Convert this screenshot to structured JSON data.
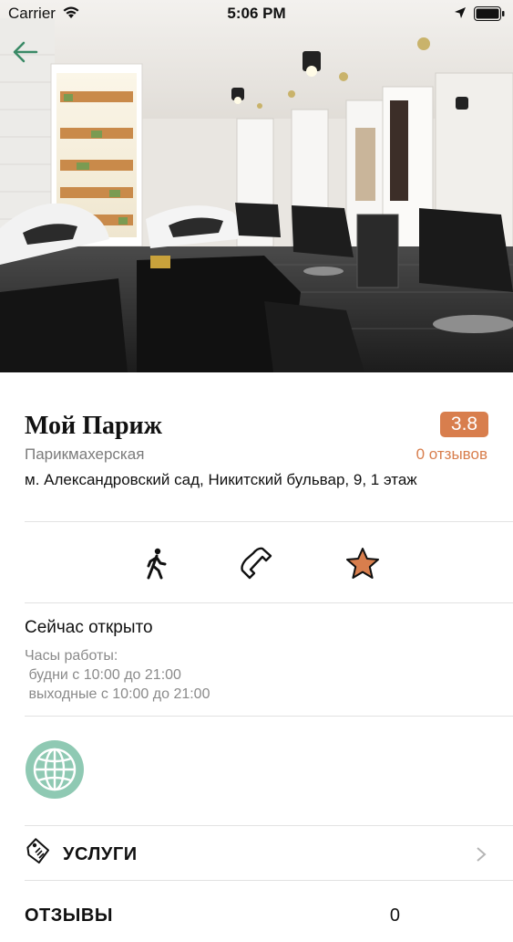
{
  "status_bar": {
    "carrier": "Carrier",
    "time": "5:06 PM"
  },
  "hero": {
    "icon": "back-arrow-icon"
  },
  "place": {
    "name": "Мой Париж",
    "category": "Парикмахерская",
    "rating": "3.8",
    "reviews_count": "0 отзывов",
    "address": "м. Александровский сад, Никитский бульвар, 9, 1 этаж"
  },
  "actions": [
    {
      "name": "route",
      "icon": "walking-person-icon"
    },
    {
      "name": "call",
      "icon": "phone-icon"
    },
    {
      "name": "favorite",
      "icon": "star-icon"
    }
  ],
  "hours": {
    "open_status": "Сейчас открыто",
    "label": "Часы работы:",
    "weekdays": " будни с 10:00 до 21:00",
    "weekends": " выходные с 10:00 до 21:00"
  },
  "website": {
    "icon": "globe-icon"
  },
  "sections": {
    "services_label": "УСЛУГИ",
    "reviews_label": "ОТЗЫВЫ",
    "reviews_count": "0"
  },
  "colors": {
    "accent": "#d87e4d",
    "globe": "#8fc9b3",
    "muted_text": "#7b7b7b",
    "divider": "#e2e2e2"
  }
}
